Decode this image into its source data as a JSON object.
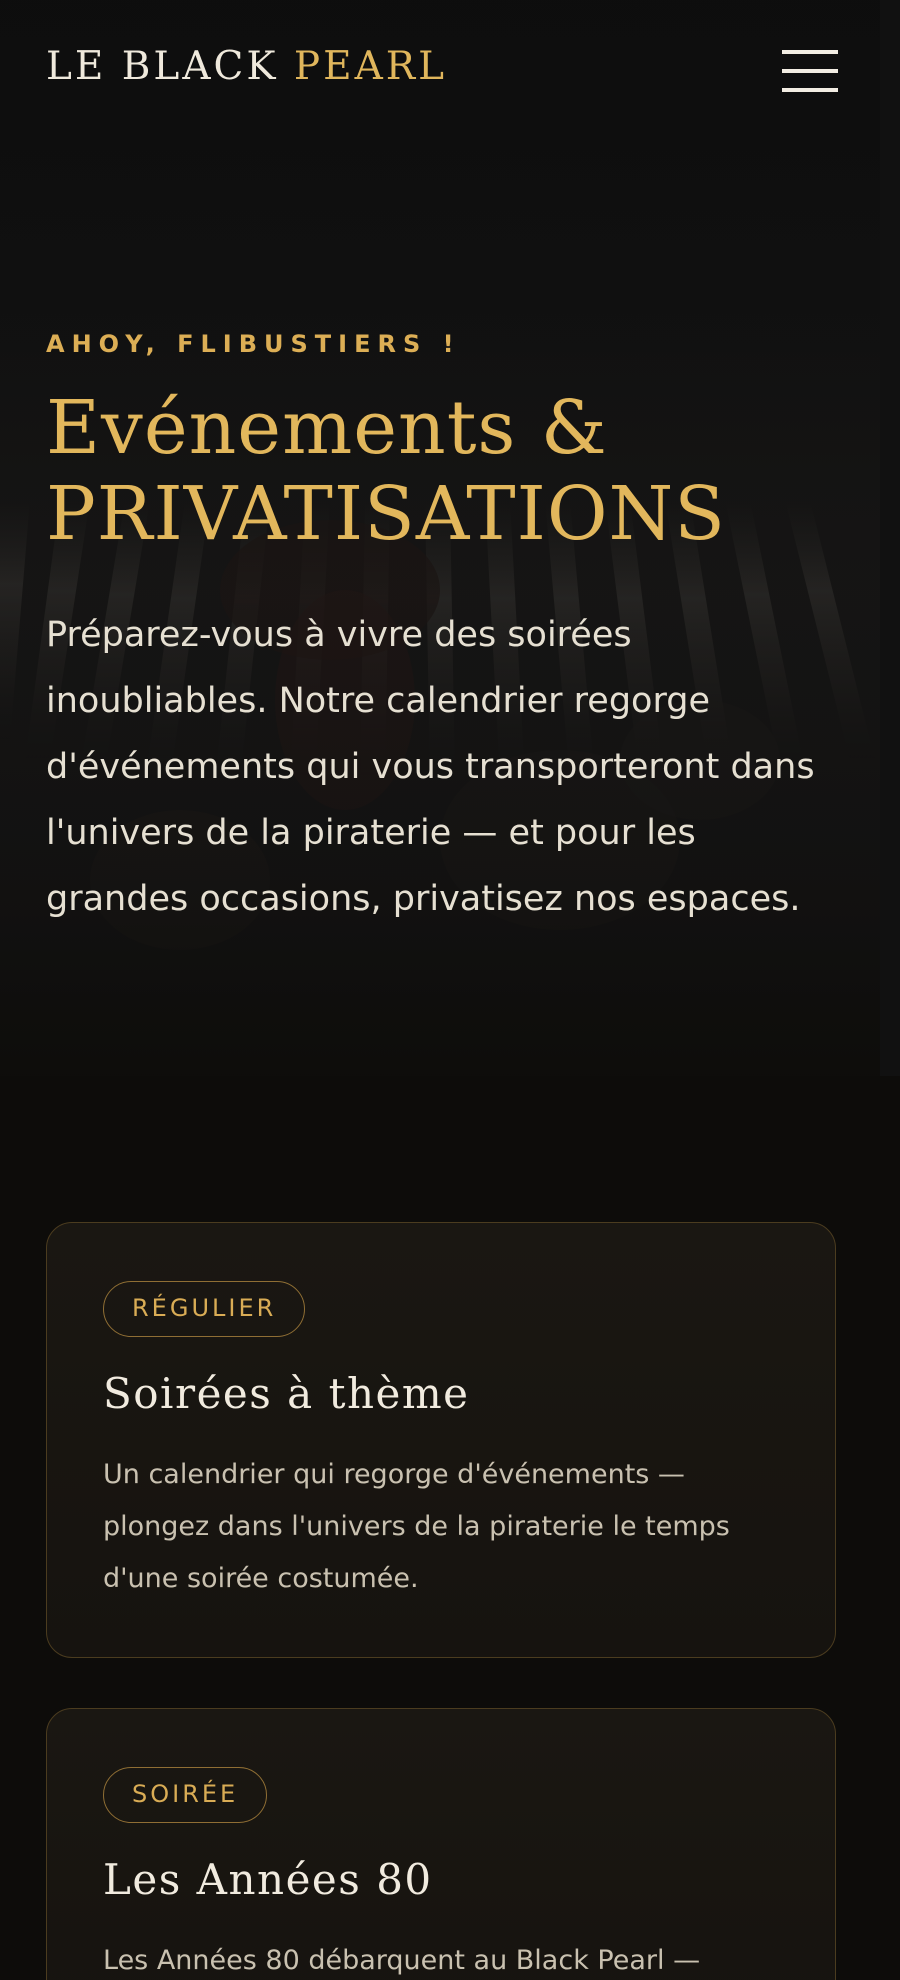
{
  "header": {
    "logo_main": "LE BLACK ",
    "logo_accent": "PEARL",
    "menu_icon": "hamburger-menu-icon"
  },
  "hero": {
    "eyebrow": "AHOY, FLIBUSTIERS !",
    "title_line1": "Evénements &",
    "title_line2": "PRIVATISATIONS",
    "intro": "Préparez-vous à vivre des soirées inoubliables. Notre calendrier regorge d'événements qui vous transporteront dans l'univers de la piraterie — et pour les grandes occasions, privatisez nos espaces."
  },
  "events": [
    {
      "badge": "RÉGULIER",
      "title": "Soirées à thème",
      "description": "Un calendrier qui regorge d'événements — plongez dans l'univers de la piraterie le temps d'une soirée costumée."
    },
    {
      "badge": "SOIRÉE",
      "title": "Les Années 80",
      "description": "Les Années 80 débarquent au Black Pearl —"
    }
  ],
  "colors": {
    "background": "#0d0c0a",
    "gold_accent": "#e0b65c",
    "text_light": "#e9e2d3",
    "card_border": "#4b3c1f"
  }
}
